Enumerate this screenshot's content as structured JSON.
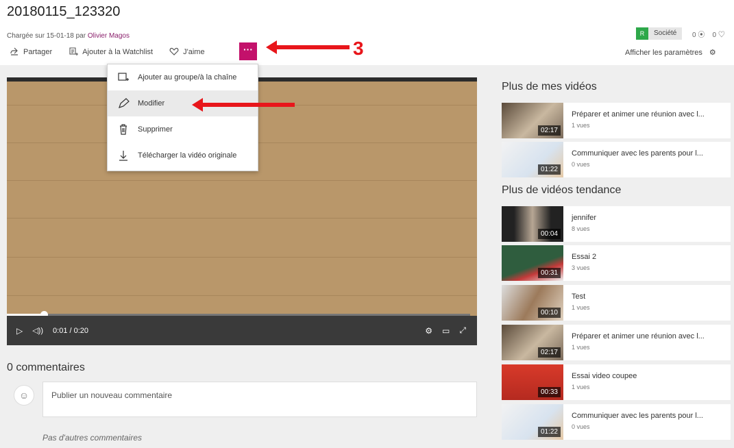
{
  "page": {
    "title": "20180115_123320",
    "uploaded_prefix": "Chargée sur 15-01-18 par ",
    "uploader": "Olivier Magos"
  },
  "actions": {
    "share": "Partager",
    "watchlist": "Ajouter à la Watchlist",
    "like": "J'aime",
    "more": "···"
  },
  "meta": {
    "company_icon": "R",
    "company": "Société",
    "views_count": "0",
    "likes_count": "0",
    "settings_label": "Afficher les paramètres"
  },
  "menu": {
    "items": [
      {
        "label": "Ajouter au groupe/à la chaîne",
        "icon": "add-to-group-icon"
      },
      {
        "label": "Modifier",
        "icon": "pencil-icon"
      },
      {
        "label": "Supprimer",
        "icon": "trash-icon"
      },
      {
        "label": "Télécharger la vidéo originale",
        "icon": "download-icon"
      }
    ]
  },
  "annotation": {
    "step_number": "3",
    "arrow_color": "#e8161b"
  },
  "player": {
    "time": "0:01 / 0:20",
    "progress": 0.05
  },
  "comments": {
    "title": "0 commentaires",
    "placeholder": "Publier un nouveau commentaire",
    "no_more": "Pas d'autres commentaires"
  },
  "sidebar": {
    "my_videos_title": "Plus de mes vidéos",
    "my_videos": [
      {
        "title": "Préparer et animer une réunion avec l...",
        "views": "1 vues",
        "duration": "02:17"
      },
      {
        "title": "Communiquer avec les parents pour l...",
        "views": "0 vues",
        "duration": "01:22"
      }
    ],
    "trending_title": "Plus de vidéos tendance",
    "trending": [
      {
        "title": "jennifer",
        "views": "8 vues",
        "duration": "00:04"
      },
      {
        "title": "Essai 2",
        "views": "3 vues",
        "duration": "00:31"
      },
      {
        "title": "Test",
        "views": "1 vues",
        "duration": "00:10"
      },
      {
        "title": "Préparer et animer une réunion avec l...",
        "views": "1 vues",
        "duration": "02:17"
      },
      {
        "title": "Essai video coupee",
        "views": "1 vues",
        "duration": "00:33"
      },
      {
        "title": "Communiquer avec les parents pour l...",
        "views": "0 vues",
        "duration": "01:22"
      }
    ]
  },
  "colors": {
    "accent": "#c3116b",
    "link": "#8a1f6b",
    "badge": "#2ea84a"
  }
}
